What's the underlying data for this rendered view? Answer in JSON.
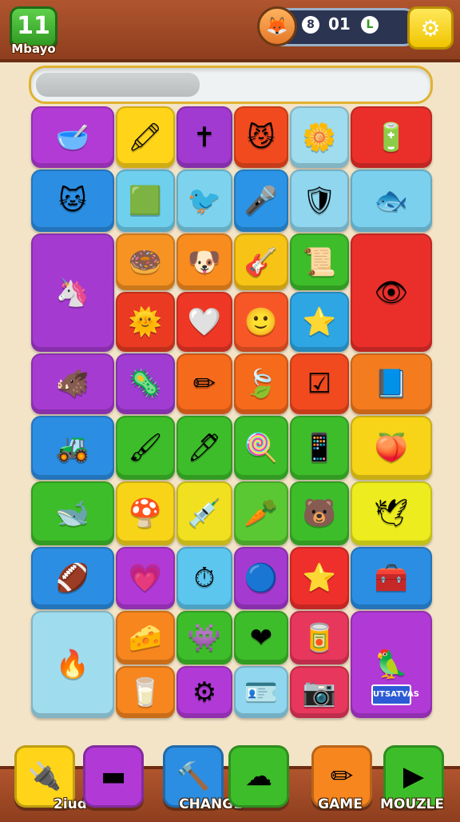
{
  "header": {
    "level_number": "11",
    "level_label": "Mbayo",
    "avatar_icon": "🦊",
    "stat_a_icon": "8",
    "stat_count": "01",
    "stat_c_icon": "L",
    "settings_icon": "⚙"
  },
  "progress": {
    "fraction": 0.42
  },
  "tiles": [
    {
      "name": "tile-bowl",
      "glyph": "🥣",
      "color": "#b23bd6"
    },
    {
      "name": "tile-crayon",
      "glyph": "🖍",
      "color": "#ffd419"
    },
    {
      "name": "tile-cross",
      "glyph": "✝",
      "color": "#a13ad0"
    },
    {
      "name": "tile-monster",
      "glyph": "😼",
      "color": "#f24a1f"
    },
    {
      "name": "tile-flower",
      "glyph": "🌼",
      "color": "#9fdcee"
    },
    {
      "name": "tile-battery",
      "glyph": "🔋",
      "color": "#ea2f2b"
    },
    {
      "name": "tile-cat",
      "glyph": "🐱",
      "color": "#2b8ee3"
    },
    {
      "name": "tile-frame",
      "glyph": "🟩",
      "color": "#6fd0ee"
    },
    {
      "name": "tile-bird",
      "glyph": "🐦",
      "color": "#7dd3ee"
    },
    {
      "name": "tile-microphone",
      "glyph": "🎤",
      "color": "#2b94e6"
    },
    {
      "name": "tile-shield",
      "glyph": "🛡",
      "color": "#8fd6ee"
    },
    {
      "name": "tile-fish",
      "glyph": "🐟",
      "color": "#7bd0ee"
    },
    {
      "name": "tile-unicorn",
      "glyph": "🦄",
      "color": "#a53ad1"
    },
    {
      "name": "tile-donut",
      "glyph": "🍩",
      "color": "#f79323"
    },
    {
      "name": "tile-dog",
      "glyph": "🐶",
      "color": "#f98c1f"
    },
    {
      "name": "tile-pick",
      "glyph": "🎸",
      "color": "#f7c416"
    },
    {
      "name": "tile-scroll",
      "glyph": "📜",
      "color": "#3ebd2a"
    },
    {
      "name": "tile-eye",
      "glyph": "👁",
      "color": "#ea2f2b"
    },
    {
      "name": "tile-sun",
      "glyph": "🌞",
      "color": "#ea3b22"
    },
    {
      "name": "tile-heart-outline",
      "glyph": "🤍",
      "color": "#ef3726"
    },
    {
      "name": "tile-face",
      "glyph": "🙂",
      "color": "#f75726"
    },
    {
      "name": "tile-star-green",
      "glyph": "⭐",
      "color": "#2fa6e4"
    },
    {
      "name": "tile-pig",
      "glyph": "🐗",
      "color": "#a63bd2"
    },
    {
      "name": "tile-germ",
      "glyph": "🦠",
      "color": "#a03cd2"
    },
    {
      "name": "tile-pencil",
      "glyph": "✏",
      "color": "#f66a1c"
    },
    {
      "name": "tile-leaf",
      "glyph": "🍃",
      "color": "#f66a1c"
    },
    {
      "name": "tile-checkbox",
      "glyph": "☑",
      "color": "#f24a1f"
    },
    {
      "name": "tile-book",
      "glyph": "📘",
      "color": "#f47c1f"
    },
    {
      "name": "tile-crane",
      "glyph": "🚜",
      "color": "#2b8ee3"
    },
    {
      "name": "tile-brush",
      "glyph": "🖌",
      "color": "#3ebd2a"
    },
    {
      "name": "tile-marker",
      "glyph": "🖊",
      "color": "#3ebd2a"
    },
    {
      "name": "tile-lollipop",
      "glyph": "🍭",
      "color": "#3ebd2a"
    },
    {
      "name": "tile-phone",
      "glyph": "📱",
      "color": "#3ebd2a"
    },
    {
      "name": "tile-peach",
      "glyph": "🍑",
      "color": "#f7d418"
    },
    {
      "name": "tile-whale",
      "glyph": "🐋",
      "color": "#3ebd2a"
    },
    {
      "name": "tile-mushroom",
      "glyph": "🍄",
      "color": "#f7d418"
    },
    {
      "name": "tile-syringe",
      "glyph": "💉",
      "color": "#f0e020"
    },
    {
      "name": "tile-popsicle",
      "glyph": "🥕",
      "color": "#5ac832"
    },
    {
      "name": "tile-bear",
      "glyph": "🐻",
      "color": "#3ebd2a"
    },
    {
      "name": "tile-bird-pink",
      "glyph": "🕊",
      "color": "#ecec1e"
    },
    {
      "name": "tile-football",
      "glyph": "🏈",
      "color": "#2b8ee3"
    },
    {
      "name": "tile-heart-bear",
      "glyph": "💗",
      "color": "#b13ad6"
    },
    {
      "name": "tile-clock",
      "glyph": "⏱",
      "color": "#5cc6ee"
    },
    {
      "name": "tile-blob",
      "glyph": "🔵",
      "color": "#a53ad1"
    },
    {
      "name": "tile-star-yellow",
      "glyph": "⭐",
      "color": "#ef2f2b"
    },
    {
      "name": "tile-box",
      "glyph": "🧰",
      "color": "#2b8ee3"
    },
    {
      "name": "tile-flame",
      "glyph": "🔥",
      "color": "#9fdcee"
    },
    {
      "name": "tile-cheese",
      "glyph": "🧀",
      "color": "#f7861f"
    },
    {
      "name": "tile-virus",
      "glyph": "👾",
      "color": "#3ebd2a"
    },
    {
      "name": "tile-heart",
      "glyph": "❤",
      "color": "#3ebd2a"
    },
    {
      "name": "tile-can",
      "glyph": "🥫",
      "color": "#e8375c"
    },
    {
      "name": "tile-parrot",
      "glyph": "🦜",
      "color": "#b13ad6",
      "label": "UTSATVAS"
    },
    {
      "name": "tile-glass",
      "glyph": "🥛",
      "color": "#f7861f"
    },
    {
      "name": "tile-gear",
      "glyph": "⚙",
      "color": "#b13ad6"
    },
    {
      "name": "tile-chip",
      "glyph": "🪪",
      "color": "#8fd6ee"
    },
    {
      "name": "tile-camera",
      "glyph": "📷",
      "color": "#e8375c"
    }
  ],
  "bottom": [
    {
      "name": "bottom-button-plug",
      "glyph": "🔌",
      "color": "#ffd419",
      "label": "2iud"
    },
    {
      "name": "bottom-button-purple",
      "glyph": "▬",
      "color": "#b13ad6",
      "label": ""
    },
    {
      "name": "bottom-button-hammer",
      "glyph": "🔨",
      "color": "#2b8ee3",
      "label": "CHANGE"
    },
    {
      "name": "bottom-button-cloud",
      "glyph": "☁",
      "color": "#3ebd2a",
      "label": ""
    },
    {
      "name": "bottom-button-game",
      "glyph": "✏",
      "color": "#f7861f",
      "label": "GAME"
    },
    {
      "name": "bottom-button-muzzle",
      "glyph": "▶",
      "color": "#3ebd2a",
      "label": "MOUZLE"
    }
  ]
}
